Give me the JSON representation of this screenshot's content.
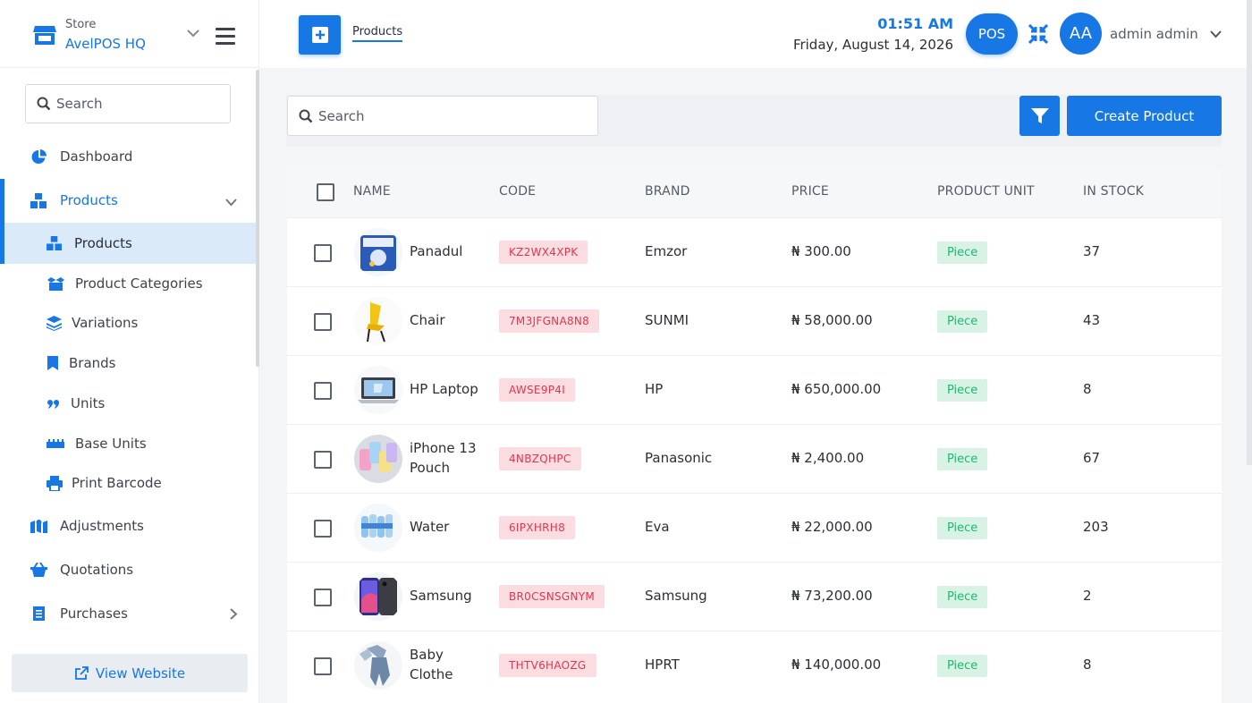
{
  "store": {
    "label": "Store",
    "name": "AvelPOS HQ"
  },
  "sidebar": {
    "search_placeholder": "Search",
    "items": [
      {
        "label": "Dashboard",
        "icon": "pie-chart-icon"
      },
      {
        "label": "Products",
        "icon": "cubes-icon"
      },
      {
        "label": "Products",
        "icon": "cubes-icon"
      },
      {
        "label": "Product Categories",
        "icon": "box-open-icon"
      },
      {
        "label": "Variations",
        "icon": "layers-icon"
      },
      {
        "label": "Brands",
        "icon": "bookmark-icon"
      },
      {
        "label": "Units",
        "icon": "quote-icon"
      },
      {
        "label": "Base Units",
        "icon": "ruler-icon"
      },
      {
        "label": "Print Barcode",
        "icon": "printer-icon"
      },
      {
        "label": "Adjustments",
        "icon": "map-icon"
      },
      {
        "label": "Quotations",
        "icon": "basket-icon"
      },
      {
        "label": "Purchases",
        "icon": "receipt-icon"
      }
    ],
    "view_website": "View Website"
  },
  "topbar": {
    "breadcrumb": "Products",
    "time": "01:51 AM",
    "date": "Friday, August 14, 2026",
    "pos": "POS",
    "avatar": "AA",
    "user": "admin admin"
  },
  "main": {
    "search_placeholder": "Search",
    "create_button": "Create Product"
  },
  "table": {
    "columns": [
      "NAME",
      "CODE",
      "BRAND",
      "PRICE",
      "PRODUCT UNIT",
      "IN STOCK"
    ],
    "rows": [
      {
        "name": "Panadul",
        "code": "KZ2WX4XPK",
        "brand": "Emzor",
        "price": "₦ 300.00",
        "unit": "Piece",
        "stock": "37"
      },
      {
        "name": "Chair",
        "code": "7M3JFGNA8N8",
        "brand": "SUNMI",
        "price": "₦ 58,000.00",
        "unit": "Piece",
        "stock": "43"
      },
      {
        "name": "HP Laptop",
        "code": "AWSE9P4I",
        "brand": "HP",
        "price": "₦ 650,000.00",
        "unit": "Piece",
        "stock": "8"
      },
      {
        "name": "iPhone 13 Pouch",
        "code": "4NBZQHPC",
        "brand": "Panasonic",
        "price": "₦ 2,400.00",
        "unit": "Piece",
        "stock": "67"
      },
      {
        "name": "Water",
        "code": "6IPXHRH8",
        "brand": "Eva",
        "price": "₦ 22,000.00",
        "unit": "Piece",
        "stock": "203"
      },
      {
        "name": "Samsung",
        "code": "BR0CSNSGNYM",
        "brand": "Samsung",
        "price": "₦ 73,200.00",
        "unit": "Piece",
        "stock": "2"
      },
      {
        "name": "Baby Clothe",
        "code": "THTV6HAOZG",
        "brand": "HPRT",
        "price": "₦ 140,000.00",
        "unit": "Piece",
        "stock": "8"
      }
    ]
  },
  "colors": {
    "accent": "#1677e5",
    "code_bg": "#fbdde1",
    "code_text": "#e0364f",
    "unit_bg": "#d8f3e6",
    "unit_text": "#1fb870"
  }
}
